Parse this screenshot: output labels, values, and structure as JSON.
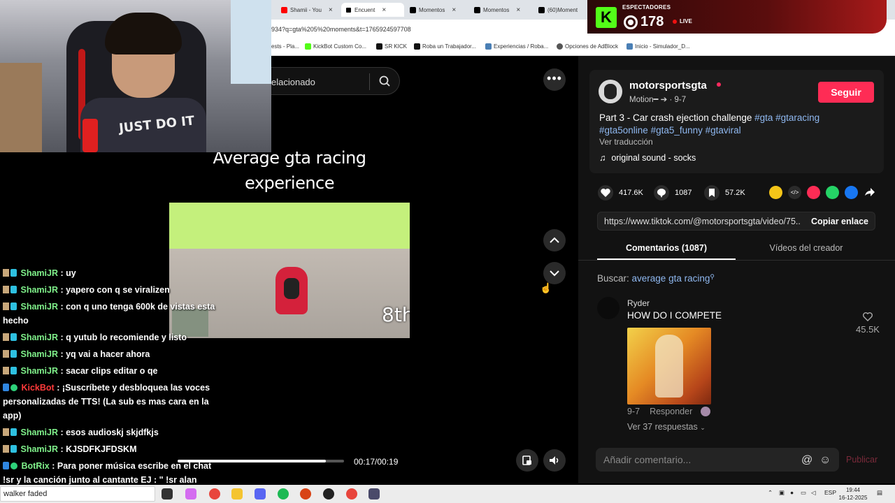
{
  "browser": {
    "tabs": [
      {
        "label": "Shamii - You",
        "color": "#ff0000"
      },
      {
        "label": "Encuent",
        "color": "#000000",
        "active": true
      },
      {
        "label": "Momentos",
        "color": "#000000"
      },
      {
        "label": "Momentos",
        "color": "#000000"
      },
      {
        "label": "(60)Moment",
        "color": "#000000"
      }
    ],
    "url": "934?q=gta%205%20moments&t=1765924597708",
    "bookmarks": [
      {
        "label": "ests - Pla...",
        "color": "#777777"
      },
      {
        "label": "KickBot Custom Co...",
        "color": "#53fc18"
      },
      {
        "label": "SR KICK",
        "color": "#111111"
      },
      {
        "label": "Roba un Trabajador...",
        "color": "#111111"
      },
      {
        "label": "Experiencias / Roba...",
        "color": "#4a7fb5"
      },
      {
        "label": "Opciones de AdBlock",
        "color": "#555555"
      },
      {
        "label": "Inicio - Simulador_D...",
        "color": "#4a7fb5"
      }
    ]
  },
  "kick_overlay": {
    "label": "ESPECTADORES",
    "logo": "K",
    "viewers": "178",
    "live": "LIVE"
  },
  "tiktok": {
    "search_text": "elacionado",
    "video": {
      "title_line1": "Average gta racing",
      "title_line2": "experience",
      "race_position": "8th",
      "time": "00:17/00:19",
      "progress": 0.89
    },
    "author": {
      "name": "motorsportsgta",
      "sub": "Motion━ ➔ · 9-7",
      "follow_label": "Seguir"
    },
    "description": {
      "text": "Part 3 - Car crash ejection challenge ",
      "tags_line1": "#gta #gtaracing",
      "tags_line2": "#gta5online #gta5_funny #gtaviral",
      "translate": "Ver traducción",
      "sound": "original sound - socks"
    },
    "actions": {
      "likes": "417.6K",
      "comments": "1087",
      "saves": "57.2K"
    },
    "share_colors": [
      "#f5c518",
      "#2b2b2b",
      "#fe2c55",
      "#25d366",
      "#1877f2"
    ],
    "link": {
      "url": "https://www.tiktok.com/@motorsportsgta/video/75...",
      "copy_label": "Copiar enlace"
    },
    "tabs": {
      "comments": "Comentarios (1087)",
      "videos": "Vídeos del creador"
    },
    "search_hint": {
      "prefix": "Buscar: ",
      "query": "average gta racing"
    },
    "comment": {
      "user": "Ryder",
      "text": "HOW DO I COMPETE",
      "likes": "45.5K",
      "date": "9-7",
      "reply": "Responder",
      "view_replies": "Ver 37 respuestas"
    },
    "comment_box": {
      "placeholder": "Añadir comentario...",
      "publish": "Publicar"
    }
  },
  "chat": [
    {
      "user": "ShamiJR",
      "text": " : uy",
      "badges": [
        "tan",
        "cyan"
      ]
    },
    {
      "user": "ShamiJR",
      "text": " : yapero con q se viralizen",
      "badges": [
        "tan",
        "cyan"
      ]
    },
    {
      "user": "ShamiJR",
      "text": " : con q uno tenga 600k de vistas esta hecho",
      "badges": [
        "tan",
        "cyan"
      ]
    },
    {
      "user": "ShamiJR",
      "text": " : q yutub lo recomiende y listo",
      "badges": [
        "tan",
        "cyan"
      ]
    },
    {
      "user": "ShamiJR",
      "text": " : yq vai a hacer ahora",
      "badges": [
        "tan",
        "cyan"
      ]
    },
    {
      "user": "ShamiJR",
      "text": " : sacar clips editar o qe",
      "badges": [
        "tan",
        "cyan"
      ]
    },
    {
      "user": "KickBot",
      "text": " : ¡Suscríbete y desbloquea las voces personalizadas de TTS! (La sub es mas cara en la app)",
      "badges": [
        "blue",
        "check"
      ]
    },
    {
      "user": "ShamiJR",
      "text": " : esos audioskj skjdfkjs",
      "badges": [
        "tan",
        "cyan"
      ]
    },
    {
      "user": "ShamiJR",
      "text": " : KJSDFKJFDSKM",
      "badges": [
        "tan",
        "cyan"
      ]
    },
    {
      "user": "BotRix",
      "text": " : Para poner música escribe en el chat !sr y la canción junto al cantante EJ : \" !sr alan",
      "badges": [
        "blue",
        "check"
      ]
    }
  ],
  "taskbar": {
    "search_text": "walker faded",
    "apps": [
      {
        "name": "task-view",
        "color": "#333333"
      },
      {
        "name": "copilot",
        "color": "#d46cf0"
      },
      {
        "name": "chrome",
        "color": "#e8453c"
      },
      {
        "name": "file-explorer",
        "color": "#f4c430"
      },
      {
        "name": "discord",
        "color": "#5865f2"
      },
      {
        "name": "spotify",
        "color": "#1db954"
      },
      {
        "name": "app-red",
        "color": "#d84315"
      },
      {
        "name": "app-dark",
        "color": "#222222"
      },
      {
        "name": "chrome-2",
        "color": "#e8453c"
      },
      {
        "name": "calculator",
        "color": "#4a4a6a"
      }
    ],
    "lang": "ESP",
    "time": "19:44",
    "date": "16-12-2025"
  }
}
